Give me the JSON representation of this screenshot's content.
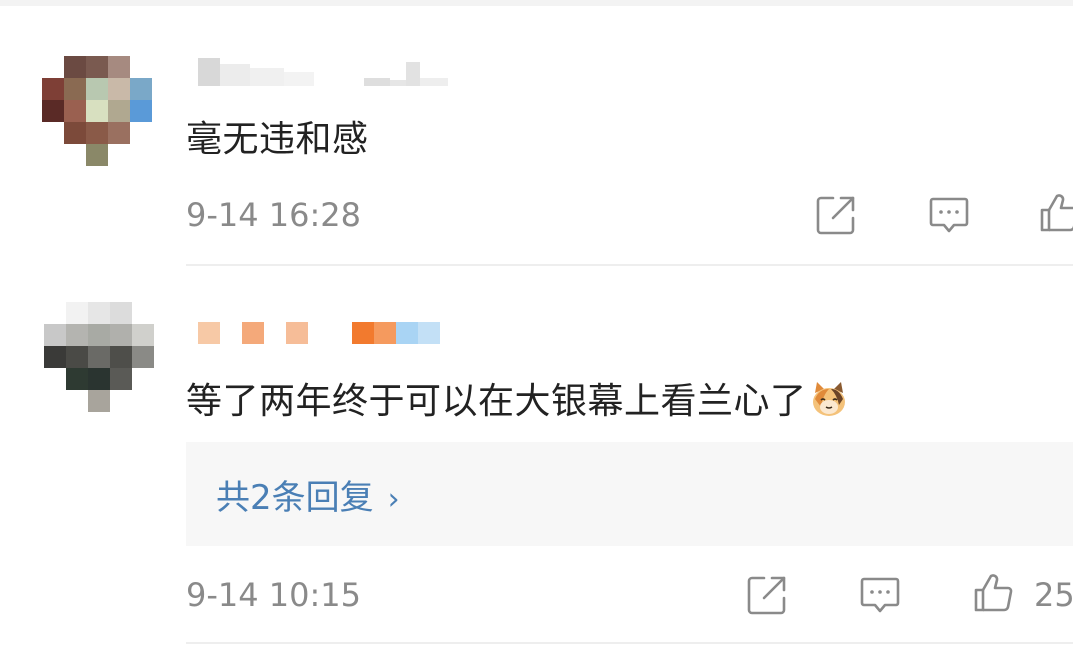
{
  "comments": [
    {
      "text": "毫无违和感",
      "timestamp": "9-14 16:28",
      "like_count": ""
    },
    {
      "text": "等了两年终于可以在大银幕上看兰心了",
      "emoji": "cat-emoji",
      "timestamp": "9-14 10:15",
      "replies_label": "共2条回复",
      "like_count": "25"
    }
  ],
  "icons": {
    "share": "share-icon",
    "comment": "comment-icon",
    "like": "thumbs-up-icon"
  },
  "colors": {
    "link": "#4a7fb5",
    "meta": "#8a8a8a",
    "text": "#222222"
  }
}
